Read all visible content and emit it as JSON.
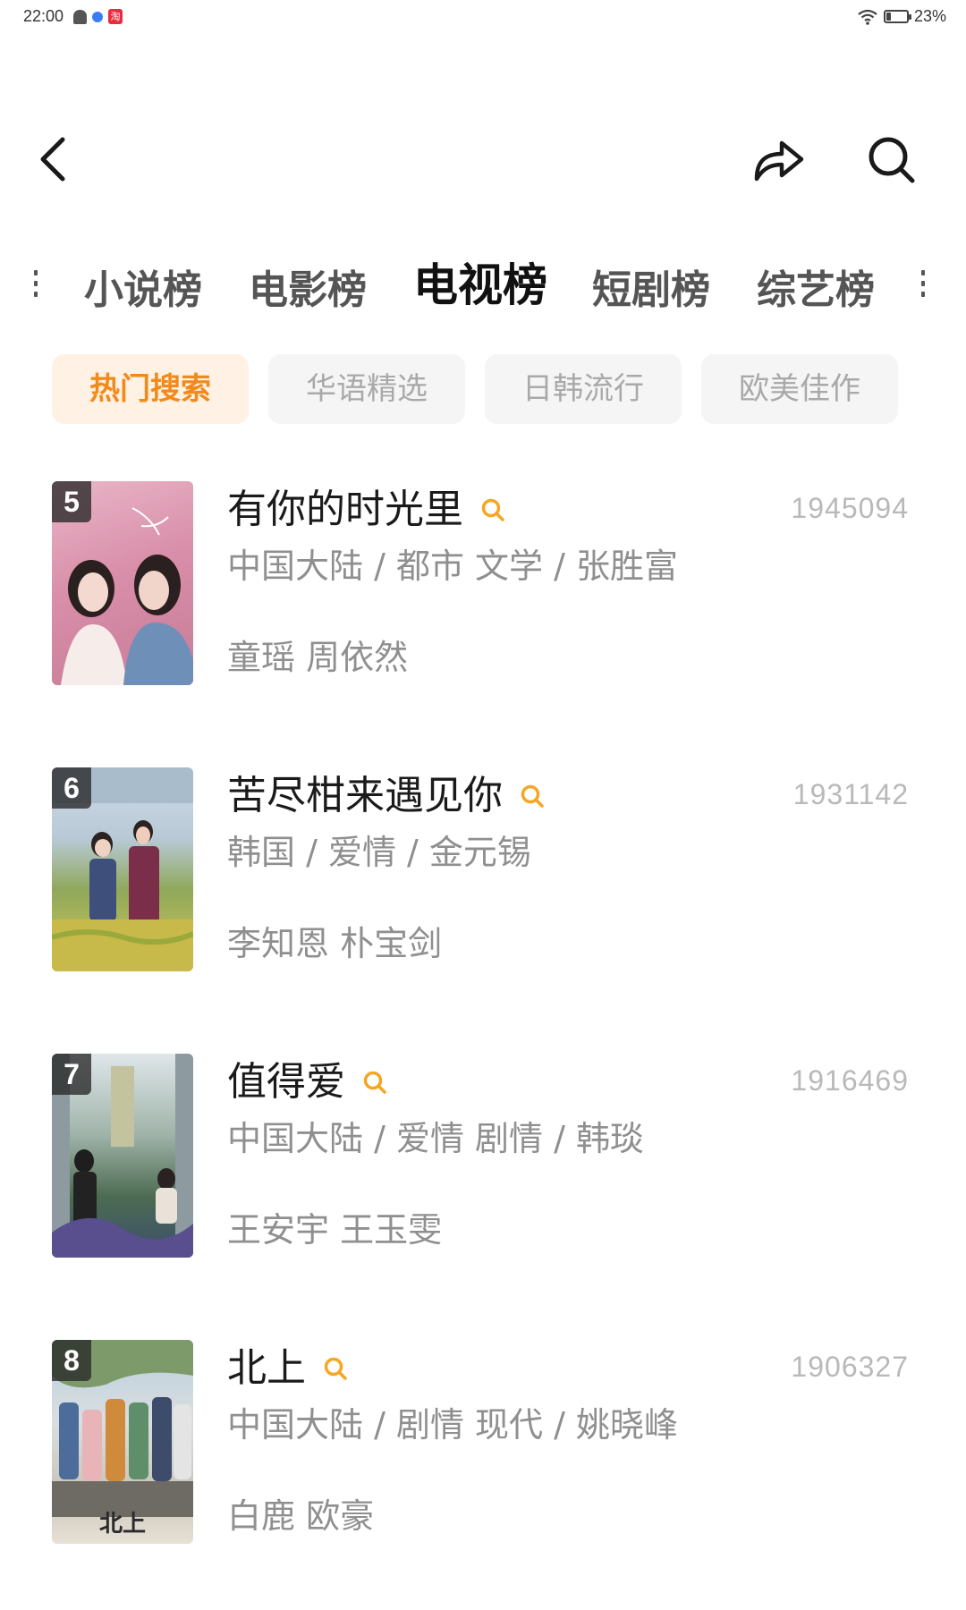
{
  "status_bar": {
    "time": "22:00",
    "battery": "23%",
    "battery_level": 0.23
  },
  "header": {
    "back_icon": "chevron-left-icon",
    "share_icon": "share-arrow-icon",
    "search_icon": "search-icon"
  },
  "category_tabs": [
    {
      "label": "小说榜",
      "active": false
    },
    {
      "label": "电影榜",
      "active": false
    },
    {
      "label": "电视榜",
      "active": true
    },
    {
      "label": "短剧榜",
      "active": false
    },
    {
      "label": "综艺榜",
      "active": false
    }
  ],
  "filter_chips": [
    {
      "label": "热门搜索",
      "active": true
    },
    {
      "label": "华语精选",
      "active": false
    },
    {
      "label": "日韩流行",
      "active": false
    },
    {
      "label": "欧美佳作",
      "active": false
    }
  ],
  "colors": {
    "accent": "#f28a1b",
    "chip_active_bg": "#fff1e3",
    "muted_text": "#8f8f8f"
  },
  "items": [
    {
      "rank": "5",
      "title": "有你的时光里",
      "count": "1945094",
      "meta": "中国大陆 / 都市 文学 / 张胜富",
      "cast": "童瑶 周依然",
      "poster_caption": ""
    },
    {
      "rank": "6",
      "title": "苦尽柑来遇见你",
      "count": "1931142",
      "meta": "韩国 / 爱情 / 金元锡",
      "cast": "李知恩 朴宝剑",
      "poster_caption": ""
    },
    {
      "rank": "7",
      "title": "值得爱",
      "count": "1916469",
      "meta": "中国大陆 / 爱情 剧情 / 韩琰",
      "cast": "王安宇 王玉雯",
      "poster_caption": ""
    },
    {
      "rank": "8",
      "title": "北上",
      "count": "1906327",
      "meta": "中国大陆 / 剧情 现代 / 姚晓峰",
      "cast": "白鹿 欧豪",
      "poster_caption": "北上"
    }
  ]
}
